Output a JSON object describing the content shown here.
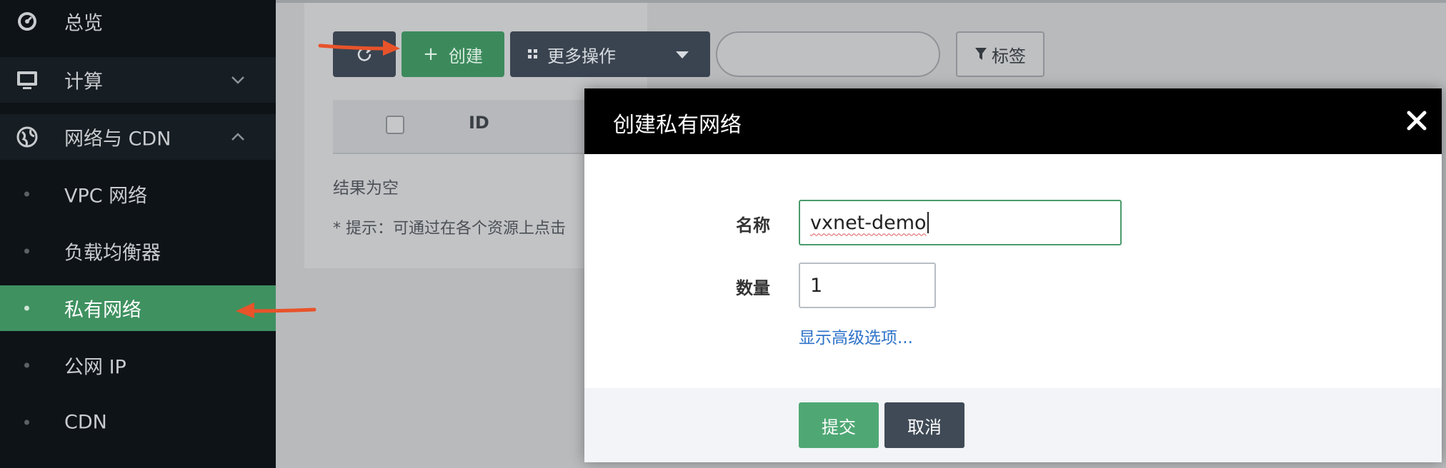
{
  "sidebar": {
    "items": [
      {
        "label": "总览",
        "icon": "dashboard-icon"
      },
      {
        "label": "计算",
        "icon": "monitor-icon"
      },
      {
        "label": "网络与 CDN",
        "icon": "globe-icon"
      },
      {
        "label": "VPC 网络"
      },
      {
        "label": "负载均衡器"
      },
      {
        "label": "私有网络"
      },
      {
        "label": "公网 IP"
      },
      {
        "label": "CDN"
      }
    ],
    "active_item": "私有网络",
    "active_color": "#3f9160"
  },
  "toolbar": {
    "create_label": "创建",
    "more_label": "更多操作",
    "tags_label": "标签",
    "search_placeholder": ""
  },
  "table": {
    "columns": [
      "ID"
    ],
    "empty_text": "结果为空",
    "hint_text": "* 提示：可通过在各个资源上点击"
  },
  "modal": {
    "title": "创建私有网络",
    "name_label": "名称",
    "name_value": "vxnet-demo",
    "quantity_label": "数量",
    "quantity_value": "1",
    "advanced_link": "显示高级选项...",
    "submit_label": "提交",
    "cancel_label": "取消"
  },
  "colors": {
    "primary_green": "#4fa874",
    "annotation_arrow": "#e8532a",
    "link_blue": "#2e73c9"
  }
}
